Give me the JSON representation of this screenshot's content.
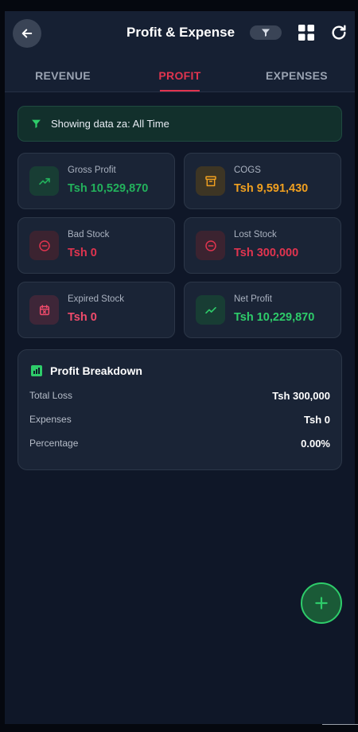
{
  "header": {
    "title": "Profit & Expense",
    "icons": [
      "back-arrow-icon",
      "filter-icon",
      "grid-icon",
      "refresh-icon"
    ]
  },
  "tabs": [
    {
      "label": "REVENUE",
      "active": false
    },
    {
      "label": "PROFIT",
      "active": true
    },
    {
      "label": "EXPENSES",
      "active": false
    }
  ],
  "notice": {
    "text": "Showing data za: All Time"
  },
  "cards": [
    {
      "label": "Gross Profit",
      "value": "Tsh 10,529,870",
      "icon": "trending-up-icon",
      "color": "#23b25c"
    },
    {
      "label": "COGS",
      "value": "Tsh 9,591,430",
      "icon": "archive-icon",
      "color": "#f0a020"
    },
    {
      "label": "Bad Stock",
      "value": "Tsh 0",
      "icon": "minus-circle-icon",
      "color": "#e0344f"
    },
    {
      "label": "Lost Stock",
      "value": "Tsh 300,000",
      "icon": "minus-circle-icon",
      "color": "#e0344f"
    },
    {
      "label": "Expired Stock",
      "value": "Tsh 0",
      "icon": "calendar-x-icon",
      "color": "#f04b6b"
    },
    {
      "label": "Net Profit",
      "value": "Tsh 10,229,870",
      "icon": "trending-up-icon",
      "color": "#2ecc6a"
    }
  ],
  "breakdown": {
    "title": "Profit Breakdown",
    "rows": [
      {
        "label": "Total Loss",
        "value": "Tsh 300,000"
      },
      {
        "label": "Expenses",
        "value": "Tsh 0"
      },
      {
        "label": "Percentage",
        "value": "0.00%"
      }
    ]
  },
  "fab": {
    "icon": "plus-icon"
  },
  "colors": {
    "accent": "#e0344f",
    "background": "#0f1728",
    "card": "#1a2436",
    "positive": "#23b25c",
    "warning": "#f0a020"
  }
}
